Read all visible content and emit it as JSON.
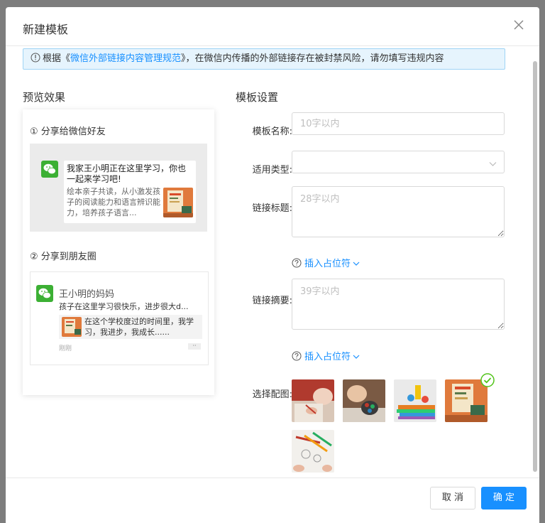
{
  "modal": {
    "title": "新建模板"
  },
  "notice": {
    "prefix": "根据《",
    "link": "微信外部链接内容管理规范",
    "suffix": "》，在微信内传播的外部链接存在被封禁风险，请勿填写违规内容"
  },
  "preview": {
    "title": "预览效果",
    "share_friend_label": "① 分享给微信好友",
    "share_moments_label": "② 分享到朋友圈",
    "bubble_title": "我家王小明正在这里学习，你也一起来学习吧!",
    "bubble_desc": "绘本亲子共读，从小激发孩子的阅读能力和语言辨识能力，培养孩子语言...",
    "moments_name": "王小明的妈妈",
    "moments_text": "孩子在这里学习很快乐，进步很大d...",
    "moments_card_text": "在这个学校度过的时间里，我学习，我进步，我成长......",
    "moments_time": "刚刚",
    "moments_more": "··"
  },
  "settings": {
    "title": "模板设置",
    "name_label": "模板名称:",
    "name_placeholder": "10字以内",
    "name_value": "",
    "type_label": "适用类型:",
    "type_value": "",
    "link_title_label": "链接标题:",
    "link_title_placeholder": "28字以内",
    "link_title_value": "",
    "insert_placeholder_1": "插入占位符",
    "summary_label": "链接摘要:",
    "summary_placeholder": "39字以内",
    "summary_value": "",
    "insert_placeholder_2": "插入占位符",
    "image_label": "选择配图:",
    "images": [
      "child-drawing",
      "child-crayons",
      "toys-books",
      "orange-book-cover",
      "pencils-paper"
    ],
    "selected_image_index": 3
  },
  "footer": {
    "cancel_label": "取 消",
    "ok_label": "确 定"
  },
  "colors": {
    "accent": "#1890ff",
    "notice_bg": "#e6f4fd",
    "notice_border": "#9fd4f5",
    "check": "#52c41a",
    "wechat_green": "#3cb034"
  }
}
